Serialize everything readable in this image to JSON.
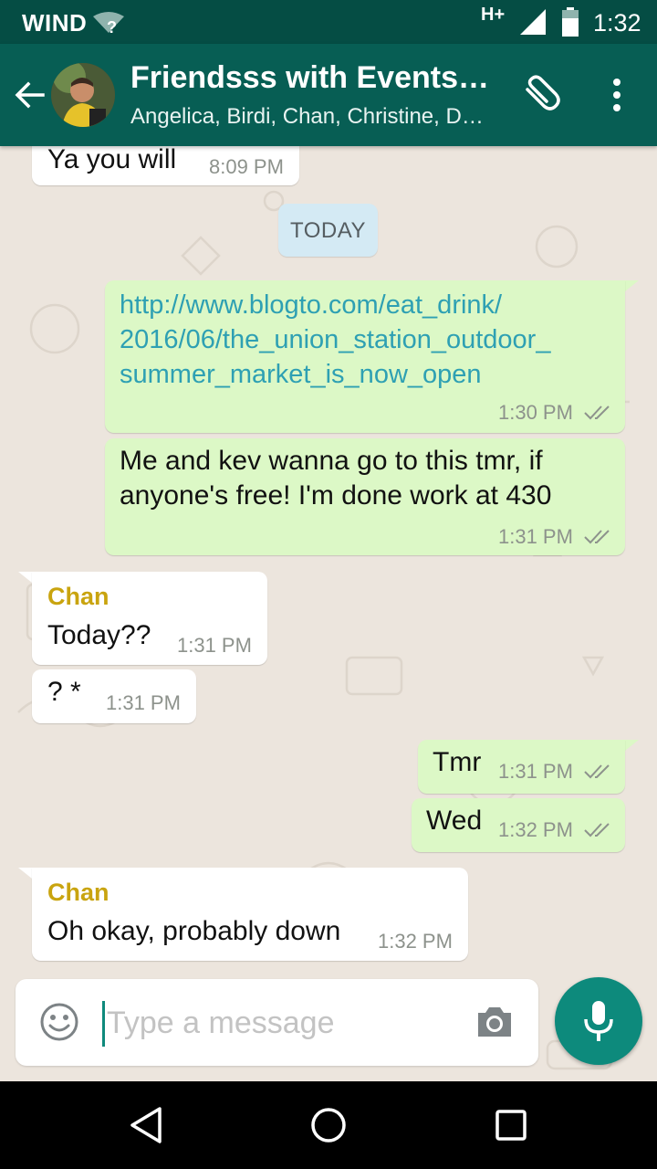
{
  "status_bar": {
    "carrier": "WIND",
    "wifi_badge": "?",
    "network_type": "H+",
    "time": "1:32",
    "icons": [
      "wifi-icon",
      "signal-icon",
      "battery-icon"
    ]
  },
  "header": {
    "title": "Friendsss with Events…",
    "subtitle": "Angelica, Birdi, Chan, Christine, D…",
    "icons": [
      "back-arrow-icon",
      "group-avatar",
      "paperclip-icon",
      "more-vert-icon"
    ]
  },
  "chat": {
    "date_chip": "TODAY",
    "messages": [
      {
        "direction": "in",
        "sender": "",
        "text": "Ya you will",
        "time": "8:09 PM"
      },
      {
        "direction": "out",
        "text_lines": [
          "http://www.blogto.com/eat_drink/",
          "2016/06/the_union_station_outdoor_",
          "summer_market_is_now_open"
        ],
        "time": "1:30 PM",
        "is_link": true,
        "status": "read"
      },
      {
        "direction": "out",
        "text_lines": [
          "Me and kev wanna go to this tmr, if",
          "anyone's free! I'm done work at 430"
        ],
        "time": "1:31 PM",
        "status": "read"
      },
      {
        "direction": "in",
        "sender": "Chan",
        "text": "Today??",
        "time": "1:31 PM"
      },
      {
        "direction": "in",
        "sender": "",
        "text": "? *",
        "time": "1:31 PM"
      },
      {
        "direction": "out",
        "text": "Tmr",
        "time": "1:31 PM",
        "status": "read"
      },
      {
        "direction": "out",
        "text": "Wed",
        "time": "1:32 PM",
        "status": "read"
      },
      {
        "direction": "in",
        "sender": "Chan",
        "text": "Oh okay, probably down",
        "time": "1:32 PM"
      }
    ]
  },
  "composer": {
    "placeholder": "Type a message",
    "value": "",
    "icons": [
      "emoji-icon",
      "camera-icon",
      "mic-icon"
    ]
  },
  "nav_bar": {
    "icons": [
      "nav-back-icon",
      "nav-home-icon",
      "nav-recents-icon"
    ]
  },
  "colors": {
    "status_bar": "#054d44",
    "header": "#075e54",
    "chat_background": "#ece5dd",
    "outgoing_bubble": "#dcf8c6",
    "incoming_bubble": "#ffffff",
    "sender_name": "#c9a40f",
    "link": "#2ea0b3",
    "accent": "#0d8a7c",
    "date_chip": "#d4eaf4"
  }
}
